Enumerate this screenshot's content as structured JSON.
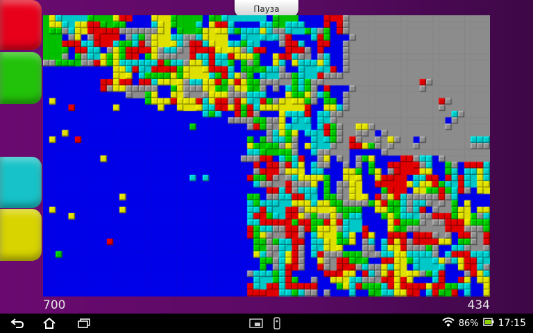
{
  "palette": {
    "red": "#e00000",
    "green": "#00c000",
    "blue": "#0000e8",
    "gray": "#8c8c8c",
    "cyan": "#00c8c8",
    "yellow": "#e0e000"
  },
  "color_buttons": [
    {
      "name": "red",
      "color": "#e8001a"
    },
    {
      "name": "green",
      "color": "#22c20a"
    },
    {
      "name": "cyan",
      "color": "#17c3c8"
    },
    {
      "name": "yellow",
      "color": "#d8d400"
    }
  ],
  "pause_label": "Пауза",
  "score_left": "700",
  "score_right": "434",
  "status": {
    "battery_percent": "86%",
    "time": "17:15"
  },
  "icons": {
    "back": "back-arrow-icon",
    "home": "home-icon",
    "recents": "recent-apps-icon",
    "mini1": "small-app-window-icon",
    "mini2": "remote-icon",
    "wifi": "wifi-icon",
    "battery": "battery-icon"
  }
}
